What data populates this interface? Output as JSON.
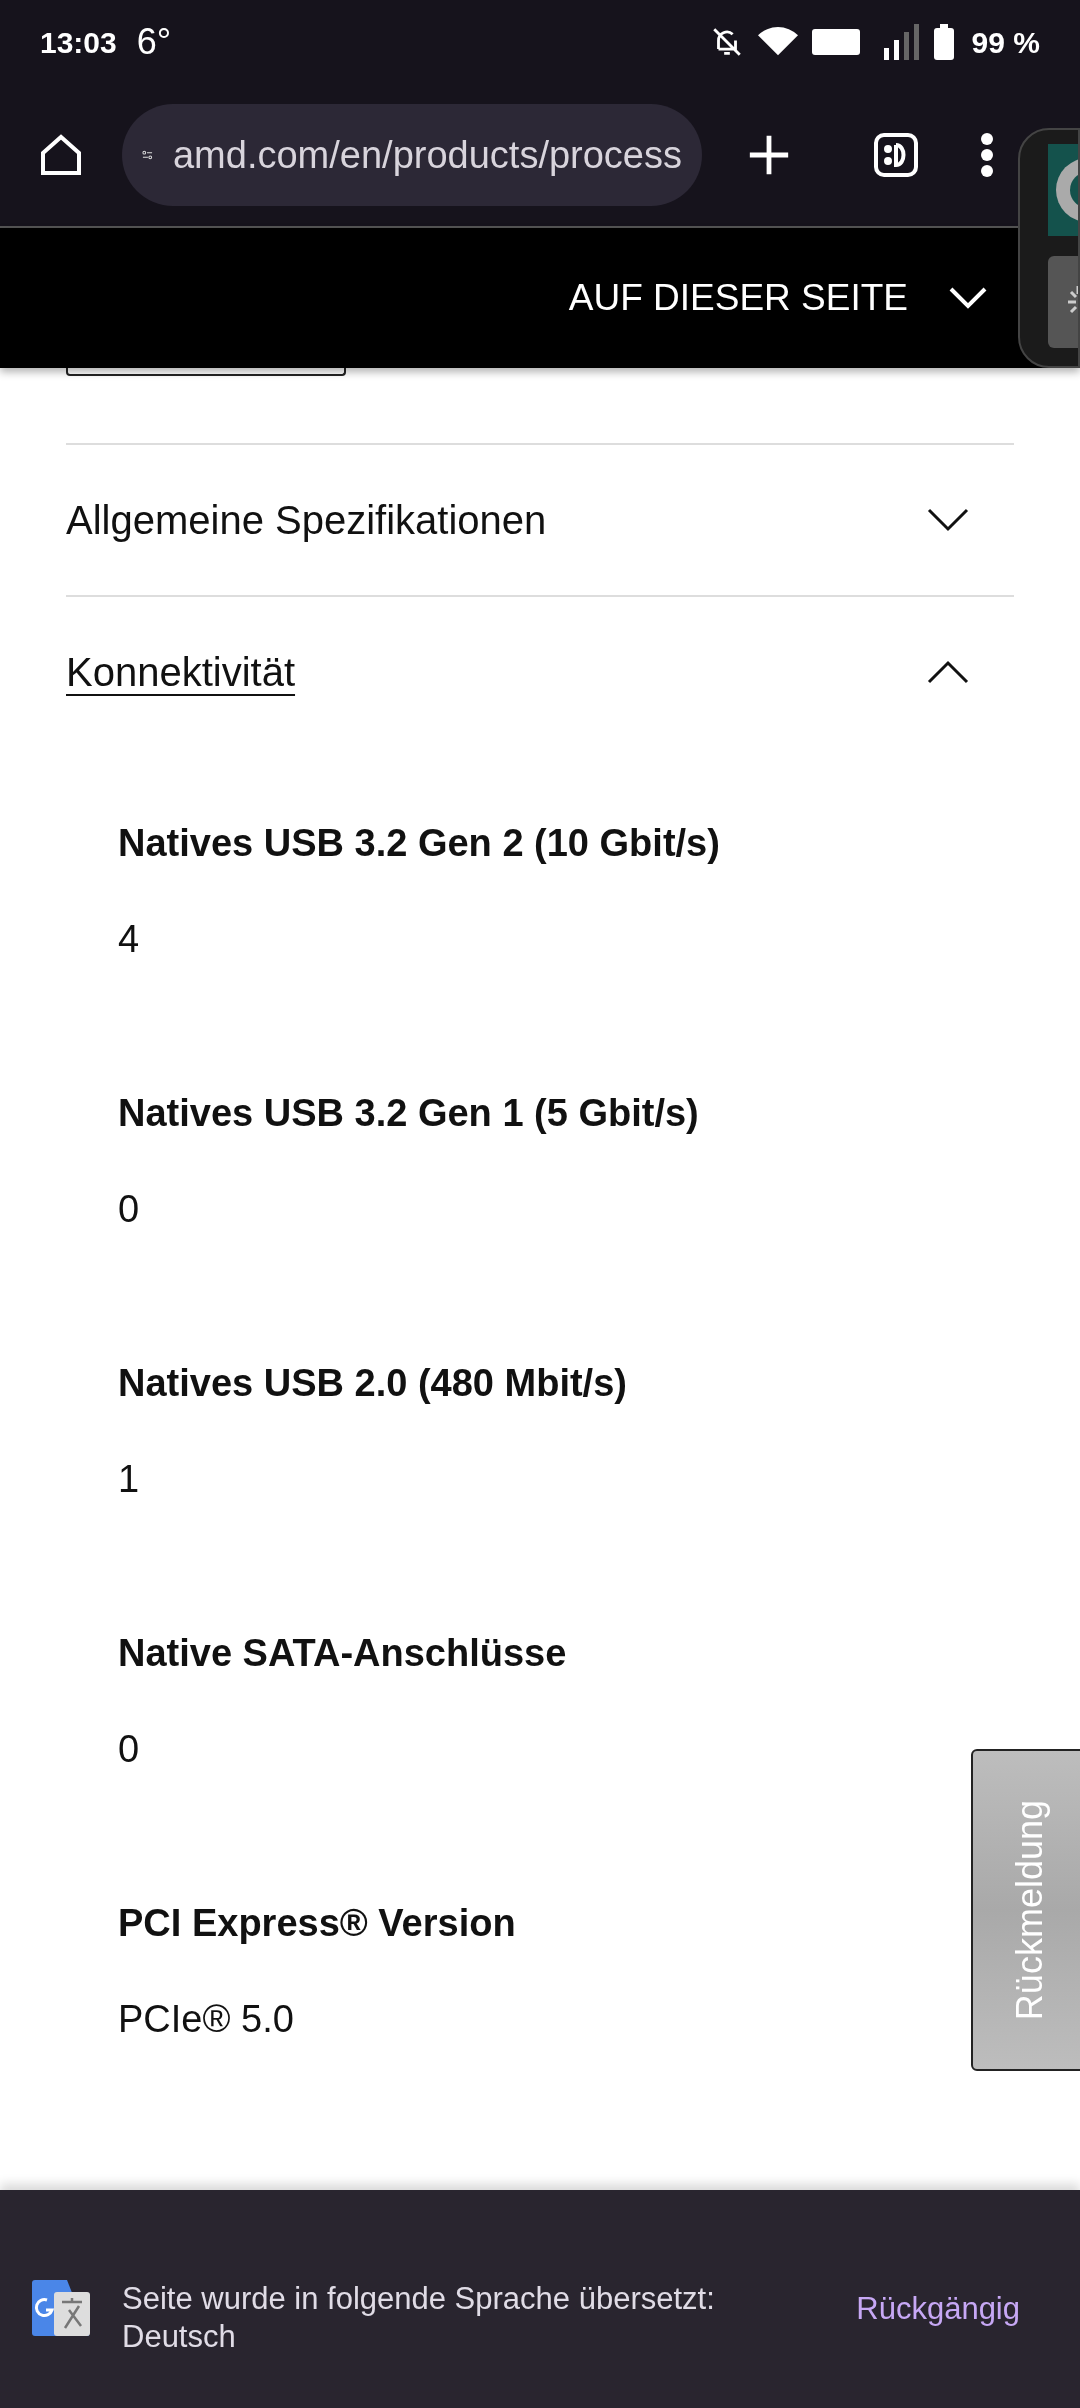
{
  "status_bar": {
    "time": "13:03",
    "temperature": "6°",
    "battery": "99 %"
  },
  "browser": {
    "url": "amd.com/en/products/process"
  },
  "page_header": {
    "label": "AUF DIESER SEITE"
  },
  "sections": [
    {
      "title": "Allgemeine Spezifikationen",
      "expanded": false
    },
    {
      "title": "Konnektivität",
      "expanded": true,
      "specs": [
        {
          "label": "Natives USB 3.2 Gen 2 (10 Gbit/s)",
          "value": "4"
        },
        {
          "label": "Natives USB 3.2 Gen 1 (5 Gbit/s)",
          "value": "0"
        },
        {
          "label": "Natives USB 2.0 (480 Mbit/s)",
          "value": "1"
        },
        {
          "label": "Native SATA-Anschlüsse",
          "value": "0"
        },
        {
          "label": "PCI Express® Version",
          "value": "PCIe® 5.0"
        }
      ]
    }
  ],
  "feedback_tab": {
    "label": "Rückmeldung"
  },
  "translate_bar": {
    "message": "Seite wurde in folgende Sprache übersetzt:",
    "language": "Deutsch",
    "action": "Rückgängig"
  }
}
